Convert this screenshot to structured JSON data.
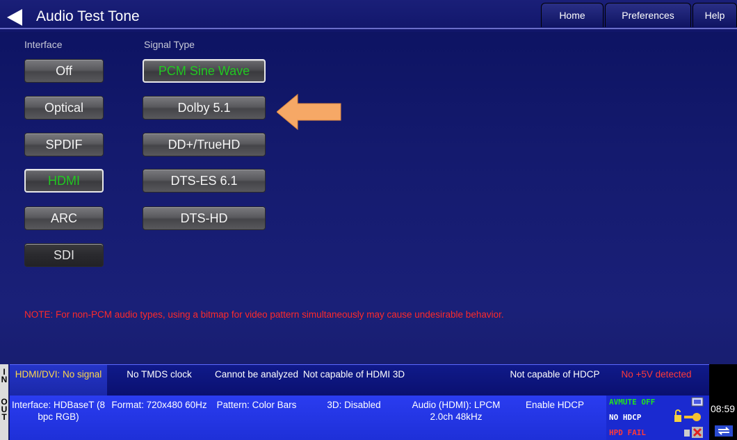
{
  "header": {
    "title": "Audio Test Tone",
    "tabs": {
      "home": "Home",
      "preferences": "Preferences",
      "help": "Help"
    }
  },
  "interface": {
    "label": "Interface",
    "buttons": [
      "Off",
      "Optical",
      "SPDIF",
      "HDMI",
      "ARC",
      "SDI"
    ],
    "selected": "HDMI"
  },
  "signal_type": {
    "label": "Signal Type",
    "buttons": [
      "PCM Sine Wave",
      "Dolby 5.1",
      "DD+/TrueHD",
      "DTS-ES 6.1",
      "DTS-HD"
    ],
    "selected": "PCM Sine Wave"
  },
  "note": "NOTE: For non-PCM audio types, using a bitmap for video pattern simultaneously may cause undesirable behavior.",
  "status_in": {
    "side_label": [
      "I",
      "N"
    ],
    "cells": [
      "HDMI/DVI: No signal",
      "No TMDS clock",
      "Cannot be analyzed",
      "Not capable of HDMI 3D",
      "",
      "Not capable of HDCP",
      "No +5V detected"
    ]
  },
  "status_out": {
    "side_label": [
      "O",
      "U",
      "T"
    ],
    "cells": [
      "Interface: HDBaseT (8 bpc RGB)",
      "Format: 720x480 60Hz",
      "Pattern: Color Bars",
      "3D: Disabled",
      "Audio (HDMI): LPCM 2.0ch 48kHz",
      "Enable HDCP"
    ],
    "indicators": {
      "avmute": "AVMUTE OFF",
      "hdcp": "NO HDCP",
      "hpd": "HPD FAIL"
    }
  },
  "clock": "08:59",
  "colors": {
    "selected_text": "#22c822",
    "note": "#ff2a2a",
    "arrow": "#f6a866"
  }
}
